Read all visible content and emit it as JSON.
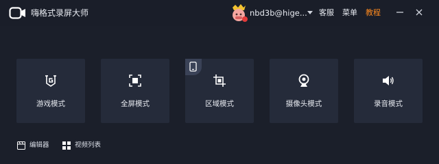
{
  "app": {
    "title": "嗨格式录屏大师"
  },
  "user": {
    "name": "nbd3b@hige..."
  },
  "header_menu": {
    "service": "客服",
    "menu": "菜单",
    "tutorial": "教程"
  },
  "colors": {
    "background": "#1b1f2a",
    "card": "#252b3a",
    "accent_tutorial": "#ff8a1e"
  },
  "modes": [
    {
      "label": "游戏模式",
      "icon": "gamepad-g-icon"
    },
    {
      "label": "全屏模式",
      "icon": "fullscreen-icon"
    },
    {
      "label": "区域模式",
      "icon": "crop-region-icon"
    },
    {
      "label": "摄像头模式",
      "icon": "webcam-icon"
    },
    {
      "label": "录音模式",
      "icon": "speaker-icon"
    }
  ],
  "tools": [
    {
      "label": "编辑器",
      "icon": "scissors-icon"
    },
    {
      "label": "视频列表",
      "icon": "grid-icon"
    }
  ]
}
